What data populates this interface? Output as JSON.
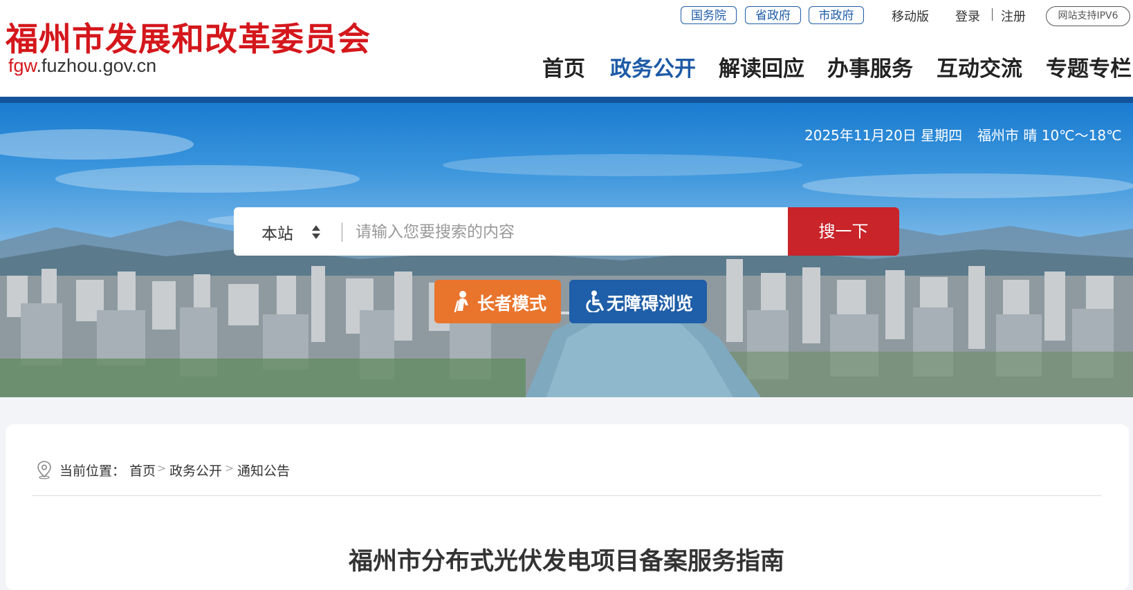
{
  "site": {
    "title": "福州市发展和改革委员会",
    "domain_prefix": "fgw",
    "domain_rest": ".fuzhou.gov.cn"
  },
  "top_links": {
    "pills": [
      "国务院",
      "省政府",
      "市政府"
    ],
    "mobile": "移动版",
    "login": "登录",
    "register": "注册",
    "ipv6": "网站支持IPV6"
  },
  "nav": {
    "items": [
      "首页",
      "政务公开",
      "解读回应",
      "办事服务",
      "互动交流",
      "专题专栏"
    ],
    "active": "政务公开"
  },
  "banner": {
    "date": "2025年11月20日 星期四",
    "weather": "福州市 晴 10℃～18℃"
  },
  "search": {
    "scope": "本站",
    "placeholder": "请输入您要搜索的内容",
    "button": "搜一下"
  },
  "modes": {
    "elder": "长者模式",
    "accessible": "无障碍浏览"
  },
  "breadcrumb": {
    "label": "当前位置：",
    "items": [
      "首页",
      "政务公开",
      "通知公告"
    ],
    "separator": ">"
  },
  "article": {
    "title": "福州市分布式光伏发电项目备案服务指南"
  },
  "colors": {
    "brand_red": "#d4171c",
    "brand_blue": "#1d5aa6",
    "search_red": "#c8242a",
    "elder_orange": "#e9742c"
  }
}
